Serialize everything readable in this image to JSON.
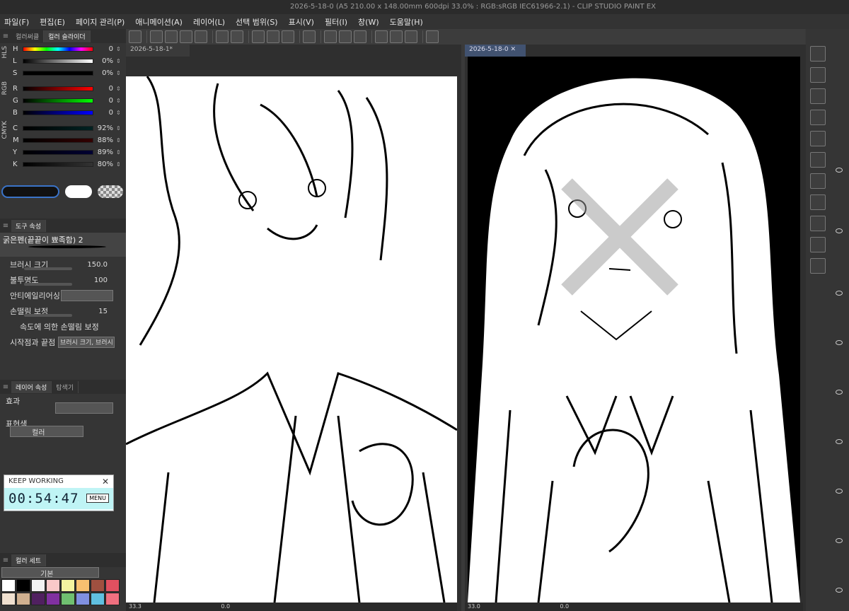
{
  "title": "2026-5-18-0 (A5 210.00 x 148.00mm 600dpi 33.0% : RGB:sRGB IEC61966-2.1) - CLIP STUDIO PAINT EX",
  "menu": [
    "파일(F)",
    "편집(E)",
    "페이지 관리(P)",
    "애니메이션(A)",
    "레이어(L)",
    "선택 범위(S)",
    "표시(V)",
    "필터(I)",
    "창(W)",
    "도움말(H)"
  ],
  "color_panel": {
    "tabs": [
      "컬러써클",
      "컬러 슬라이더"
    ],
    "groups": [
      "HLS",
      "RGB",
      "CMYK"
    ],
    "sliders": [
      {
        "label": "H",
        "value": "0"
      },
      {
        "label": "L",
        "value": "0%"
      },
      {
        "label": "S",
        "value": "0%"
      },
      {
        "label": "R",
        "value": "0"
      },
      {
        "label": "G",
        "value": "0"
      },
      {
        "label": "B",
        "value": "0"
      },
      {
        "label": "C",
        "value": "92%"
      },
      {
        "label": "M",
        "value": "88%"
      },
      {
        "label": "Y",
        "value": "89%"
      },
      {
        "label": "K",
        "value": "80%"
      }
    ]
  },
  "tool_panel": {
    "tab": "도구 속성",
    "brush_name": "굵은펜(끝끝이 뾰족함) 2",
    "brush_size_label": "브러시 크기",
    "brush_size": "150.0",
    "opacity_label": "불투명도",
    "opacity": "100",
    "aa_label": "안티에일리어싱",
    "stab_label": "손떨림 보정",
    "stab": "15",
    "speed_label": "속도에 의한 손떨림 보정",
    "start_end_label": "시작점과 끝점",
    "start_end_value": "브러시 크기, 브러시"
  },
  "layer_panel": {
    "tabs": [
      "레이어 속성",
      "탐색기"
    ],
    "effect_label": "효과",
    "expr_label": "표현색",
    "expr_value": "컬러"
  },
  "timer": {
    "header": "KEEP WORKING",
    "time": "00:54:47",
    "menu": "MENU"
  },
  "color_set": {
    "tabs": [
      "컬러 세트"
    ],
    "name": "기본",
    "colors": [
      "#ffffff",
      "#000000",
      "#f2f2f2",
      "#f9c9c9",
      "#f4f4a0",
      "#f8c070",
      "#a05040",
      "#e05060",
      "#f0e0d0",
      "#d0b090",
      "#502060",
      "#8030a0",
      "#70c070",
      "#8090e0",
      "#60c0e0",
      "#f07080"
    ]
  },
  "canvas1": {
    "tab": "2026-5-18-1*",
    "zoom": "33.3",
    "angle": "0.0"
  },
  "canvas2": {
    "tab": "2026-5-18-0",
    "zoom": "33.0",
    "angle": "0.0"
  }
}
